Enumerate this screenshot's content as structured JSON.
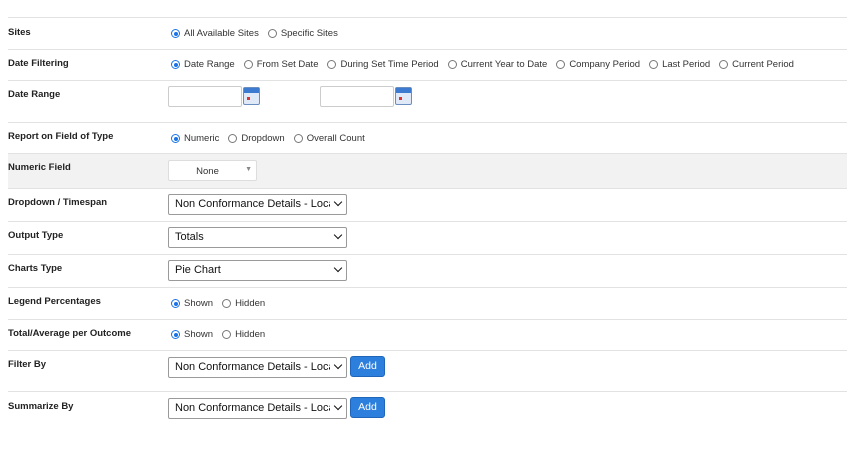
{
  "sites": {
    "label": "Sites",
    "options": [
      "All Available Sites",
      "Specific Sites"
    ],
    "selected": 0
  },
  "date_filtering": {
    "label": "Date Filtering",
    "options": [
      "Date Range",
      "From Set Date",
      "During Set Time Period",
      "Current Year to Date",
      "Company Period",
      "Last Period",
      "Current Period"
    ],
    "selected": 0
  },
  "date_range": {
    "label": "Date Range",
    "from_value": "",
    "to_value": ""
  },
  "report_field_type": {
    "label": "Report on Field of Type",
    "options": [
      "Numeric",
      "Dropdown",
      "Overall Count"
    ],
    "selected": 0
  },
  "numeric_field": {
    "label": "Numeric Field",
    "value": "None"
  },
  "dropdown_timespan": {
    "label": "Dropdown / Timespan",
    "value": "Non Conformance Details - Locat"
  },
  "output_type": {
    "label": "Output Type",
    "value": "Totals"
  },
  "charts_type": {
    "label": "Charts Type",
    "value": "Pie Chart"
  },
  "legend_percentages": {
    "label": "Legend Percentages",
    "options": [
      "Shown",
      "Hidden"
    ],
    "selected": 0
  },
  "total_average": {
    "label": "Total/Average per Outcome",
    "options": [
      "Shown",
      "Hidden"
    ],
    "selected": 0
  },
  "filter_by": {
    "label": "Filter By",
    "value": "Non Conformance Details - Locat",
    "add_label": "Add"
  },
  "summarize_by": {
    "label": "Summarize By",
    "value": "Non Conformance Details - Locat",
    "add_label": "Add"
  },
  "colors": {
    "accent": "#1a73e8",
    "button": "#2d7fdd",
    "row_alt": "#f2f2f2"
  }
}
